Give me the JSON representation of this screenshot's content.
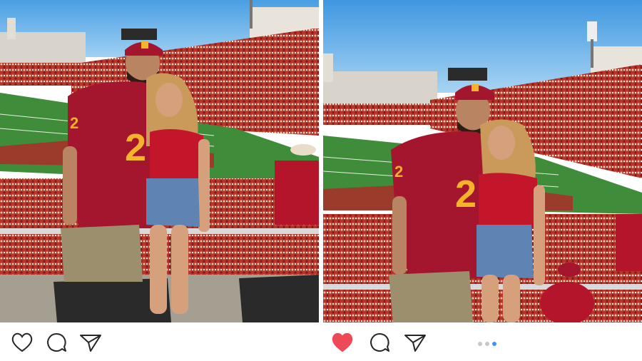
{
  "posts": [
    {
      "id_label": "post-left",
      "liked": false,
      "show_dots": false,
      "carousel": {
        "count": 0,
        "active": 0
      }
    },
    {
      "id_label": "post-right",
      "liked": true,
      "show_dots": true,
      "carousel": {
        "count": 3,
        "active": 3
      }
    }
  ],
  "icons": {
    "like": "heart-icon",
    "comment": "comment-bubble-icon",
    "share": "paper-plane-icon"
  },
  "colors": {
    "like_active": "#ed4956",
    "icon_stroke": "#262626",
    "dot_inactive": "#c7c7c7",
    "dot_active": "#3897f0",
    "sky": "#5aa9e6",
    "field": "#3c8a3a",
    "crowd": "#c0392b",
    "jersey": "#a3162d",
    "jersey_number": "#f3b32a"
  }
}
